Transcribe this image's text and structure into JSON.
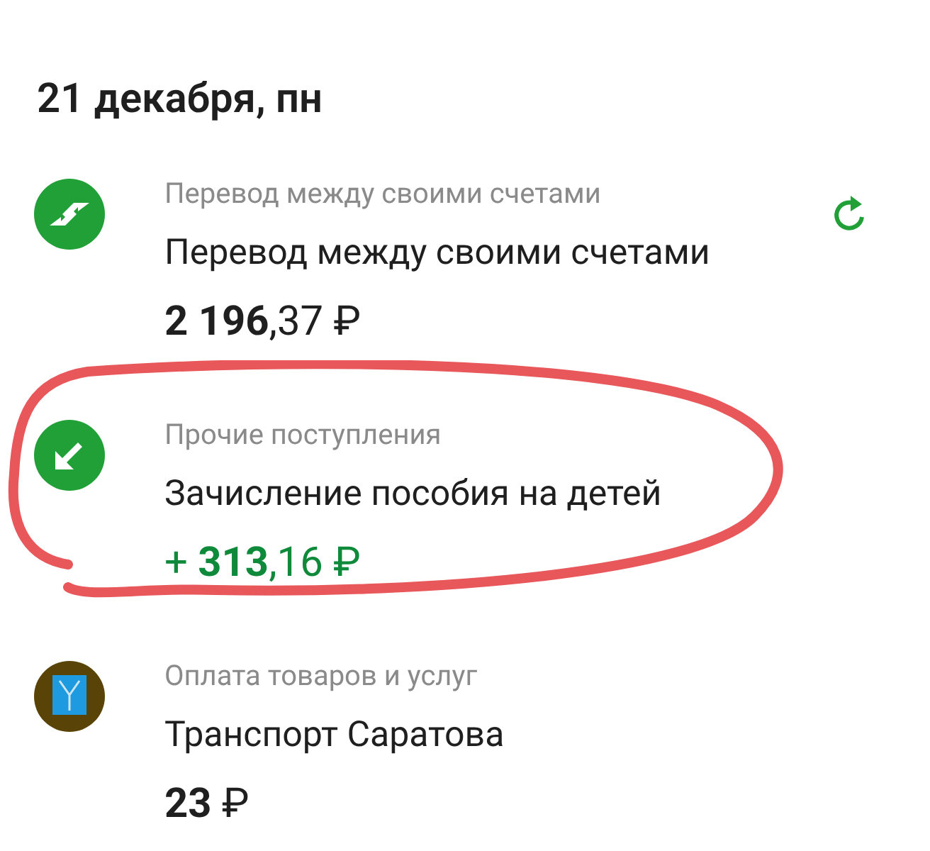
{
  "date_header": "21 декабря, пн",
  "transactions": [
    {
      "kind": "transfer",
      "category": "Перевод между своими счетами",
      "title": "Перевод между своими счетами",
      "amount": "**2 196**,37 ₽",
      "repeat": true,
      "highlighted": false
    },
    {
      "kind": "income",
      "category": "Прочие поступления",
      "title": "Зачисление пособия на детей",
      "amount": "+ **313**,16 ₽",
      "repeat": false,
      "highlighted": true
    },
    {
      "kind": "emblem",
      "category": "Оплата товаров и услуг",
      "title": "Транспорт Саратова",
      "amount": "**23** ₽",
      "repeat": false,
      "highlighted": false
    }
  ]
}
